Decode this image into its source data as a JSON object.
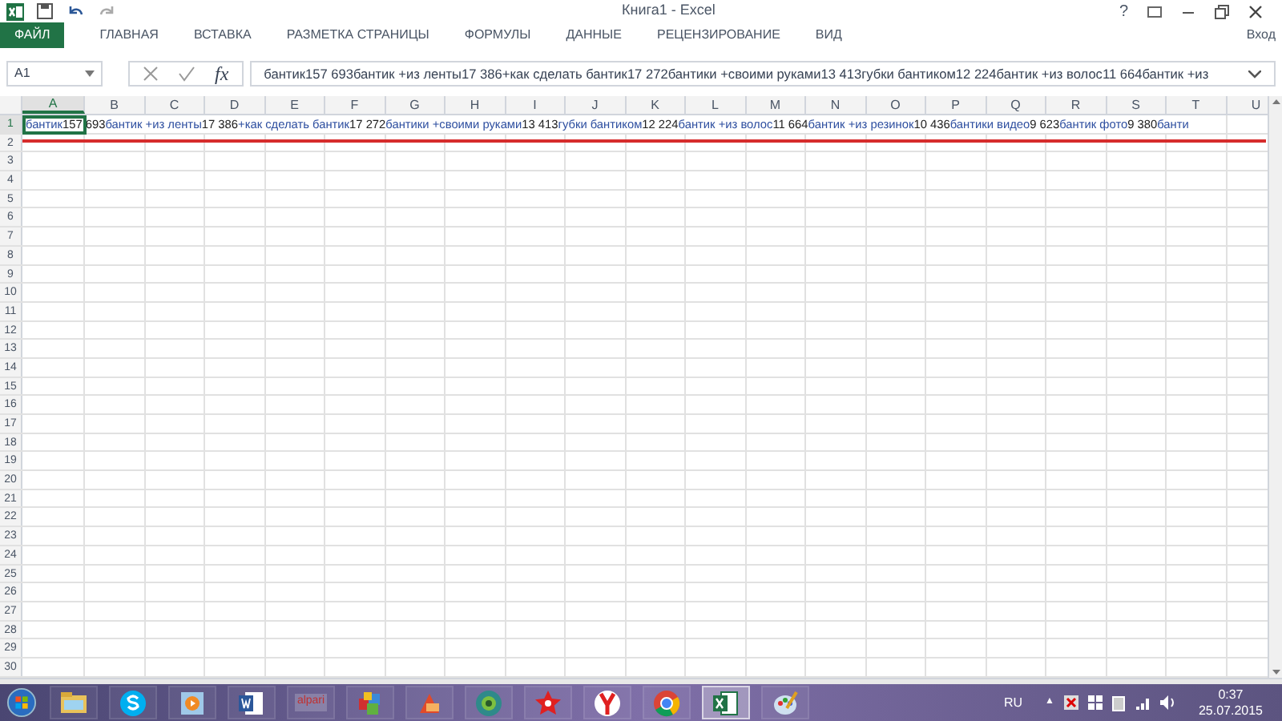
{
  "window": {
    "title": "Книга1 - Excel",
    "controls": [
      "?"
    ]
  },
  "ribbon": {
    "tabs": [
      {
        "label": "ФАЙЛ",
        "kind": "file",
        "selected": false
      },
      {
        "label": "ГЛАВНАЯ",
        "kind": "tab",
        "selected": false
      },
      {
        "label": "ВСТАВКА",
        "kind": "tab",
        "selected": false
      },
      {
        "label": "РАЗМЕТКА СТРАНИЦЫ",
        "kind": "tab",
        "selected": false
      },
      {
        "label": "ФОРМУЛЫ",
        "kind": "tab",
        "selected": false
      },
      {
        "label": "ДАННЫЕ",
        "kind": "tab",
        "selected": false
      },
      {
        "label": "РЕЦЕНЗИРОВАНИЕ",
        "kind": "tab",
        "selected": false
      },
      {
        "label": "ВИД",
        "kind": "tab",
        "selected": false
      }
    ],
    "sign_in": "Вход"
  },
  "formula_bar": {
    "name_box": "A1",
    "fx": "fx",
    "formula": "бантик157 693бантик +из ленты17 386+как сделать бантик17 272бантики +своими руками13 413губки бантиком12 224бантик +из волос11 664бантик +из"
  },
  "sheet": {
    "columns": [
      {
        "label": "A",
        "selected": true
      },
      {
        "label": "B",
        "selected": false
      },
      {
        "label": "C",
        "selected": false
      },
      {
        "label": "D",
        "selected": false
      },
      {
        "label": "E",
        "selected": false
      },
      {
        "label": "F",
        "selected": false
      },
      {
        "label": "G",
        "selected": false
      },
      {
        "label": "H",
        "selected": false
      },
      {
        "label": "I",
        "selected": false
      },
      {
        "label": "J",
        "selected": false
      },
      {
        "label": "K",
        "selected": false
      },
      {
        "label": "L",
        "selected": false
      },
      {
        "label": "M",
        "selected": false
      },
      {
        "label": "N",
        "selected": false
      },
      {
        "label": "O",
        "selected": false
      },
      {
        "label": "P",
        "selected": false
      },
      {
        "label": "Q",
        "selected": false
      },
      {
        "label": "R",
        "selected": false
      },
      {
        "label": "S",
        "selected": false
      },
      {
        "label": "T",
        "selected": false
      },
      {
        "label": "U",
        "selected": false
      }
    ],
    "rows": [
      {
        "label": "1",
        "selected": true
      },
      {
        "label": "2",
        "selected": false
      },
      {
        "label": "3",
        "selected": false
      },
      {
        "label": "4",
        "selected": false
      },
      {
        "label": "5",
        "selected": false
      },
      {
        "label": "6",
        "selected": false
      },
      {
        "label": "7",
        "selected": false
      },
      {
        "label": "8",
        "selected": false
      },
      {
        "label": "9",
        "selected": false
      },
      {
        "label": "10",
        "selected": false
      },
      {
        "label": "11",
        "selected": false
      },
      {
        "label": "12",
        "selected": false
      },
      {
        "label": "13",
        "selected": false
      },
      {
        "label": "14",
        "selected": false
      },
      {
        "label": "15",
        "selected": false
      },
      {
        "label": "16",
        "selected": false
      },
      {
        "label": "17",
        "selected": false
      },
      {
        "label": "18",
        "selected": false
      },
      {
        "label": "19",
        "selected": false
      },
      {
        "label": "20",
        "selected": false
      },
      {
        "label": "21",
        "selected": false
      },
      {
        "label": "22",
        "selected": false
      },
      {
        "label": "23",
        "selected": false
      },
      {
        "label": "24",
        "selected": false
      },
      {
        "label": "25",
        "selected": false
      },
      {
        "label": "26",
        "selected": false
      },
      {
        "label": "27",
        "selected": false
      },
      {
        "label": "28",
        "selected": false
      },
      {
        "label": "29",
        "selected": false
      },
      {
        "label": "30",
        "selected": false
      }
    ],
    "row_1_text": [
      {
        "text": "бантик",
        "kind": "query"
      },
      {
        "text": "157 693",
        "kind": "count"
      },
      {
        "text": "бантик +из ленты",
        "kind": "query"
      },
      {
        "text": "17 386",
        "kind": "count"
      },
      {
        "text": "+как сделать бантик",
        "kind": "query"
      },
      {
        "text": "17 272",
        "kind": "count"
      },
      {
        "text": "бантики +своими руками",
        "kind": "query"
      },
      {
        "text": "13 413",
        "kind": "count"
      },
      {
        "text": "губки бантиком",
        "kind": "query"
      },
      {
        "text": "12 224",
        "kind": "count"
      },
      {
        "text": "бантик +из волос",
        "kind": "query"
      },
      {
        "text": "11 664",
        "kind": "count"
      },
      {
        "text": "бантик +из резинок",
        "kind": "query"
      },
      {
        "text": "10 436",
        "kind": "count"
      },
      {
        "text": "бантики видео",
        "kind": "query"
      },
      {
        "text": "9 623",
        "kind": "count"
      },
      {
        "text": "бантик фото",
        "kind": "query"
      },
      {
        "text": "9 380",
        "kind": "count"
      },
      {
        "text": "банти",
        "kind": "query"
      }
    ]
  },
  "taskbar": {
    "apps": [
      {
        "kind": "folder",
        "selected": false
      },
      {
        "kind": "skype",
        "selected": false
      },
      {
        "kind": "player",
        "selected": false
      },
      {
        "kind": "word",
        "selected": false
      },
      {
        "kind": "alpari",
        "label": "alpari",
        "selected": false
      },
      {
        "kind": "cubes",
        "selected": false
      },
      {
        "kind": "paint",
        "selected": false
      },
      {
        "kind": "globe",
        "selected": false
      },
      {
        "kind": "star",
        "selected": false
      },
      {
        "kind": "yandex",
        "selected": false
      },
      {
        "kind": "chrome",
        "selected": false
      },
      {
        "kind": "excel",
        "selected": true
      },
      {
        "kind": "palette",
        "selected": false
      }
    ],
    "language": "RU",
    "tray_arrow": "▲",
    "time": "0:37",
    "date": "25.07.2015"
  }
}
